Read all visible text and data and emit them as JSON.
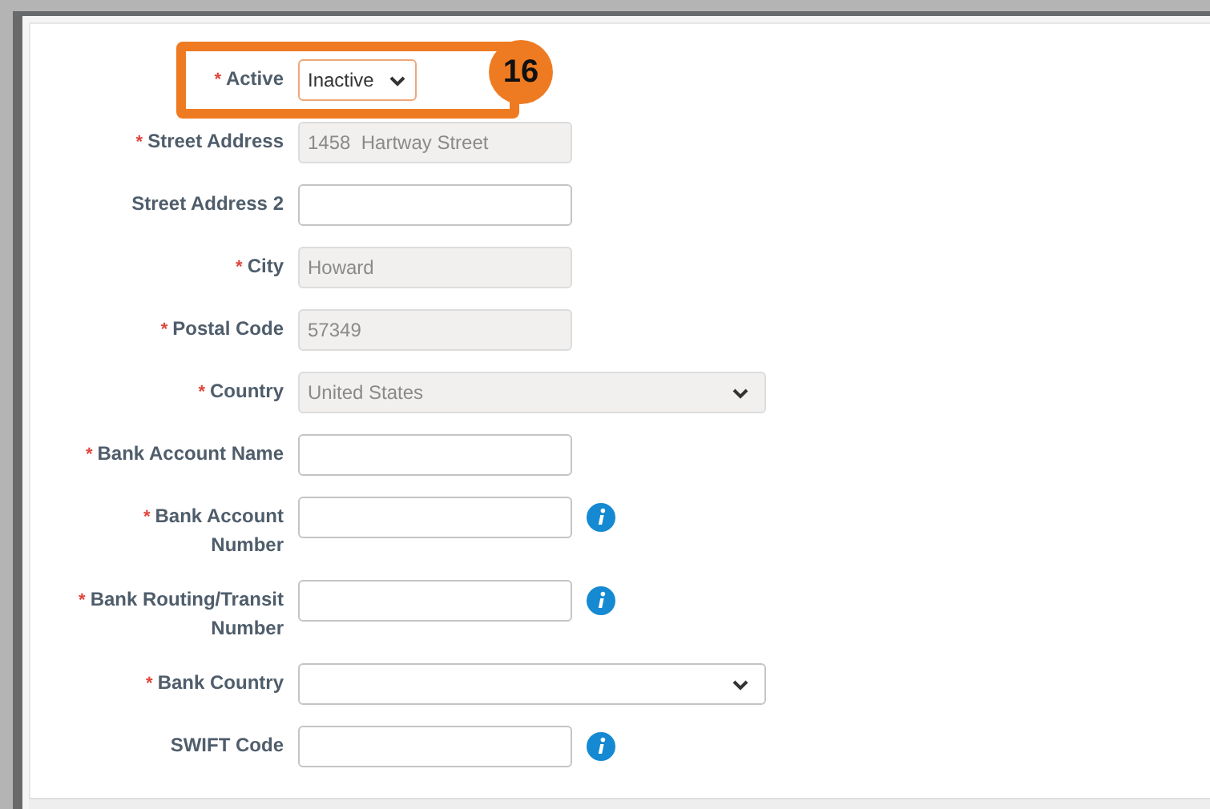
{
  "fields": [
    {
      "label": "Active",
      "required_mark": "*",
      "kind": "compact-select",
      "value": "Inactive",
      "disabled": false,
      "info": false,
      "highlighted": true,
      "callout": "16"
    },
    {
      "label": "Street Address",
      "required_mark": "*",
      "kind": "text",
      "value": "1458  Hartway Street",
      "disabled": true,
      "info": false,
      "highlighted": false
    },
    {
      "label": "Street Address 2",
      "kind": "text",
      "disabled": false,
      "info": false,
      "highlighted": false
    },
    {
      "label": "City",
      "required_mark": "*",
      "kind": "text",
      "value": "Howard",
      "disabled": true,
      "info": false,
      "highlighted": false
    },
    {
      "label": "Postal Code",
      "required_mark": "*",
      "kind": "text",
      "value": "57349",
      "disabled": true,
      "info": false,
      "highlighted": false
    },
    {
      "label": "Country",
      "required_mark": "*",
      "kind": "select",
      "value": "United States",
      "disabled": true,
      "info": false,
      "highlighted": false
    },
    {
      "label": "Bank Account Name",
      "required_mark": "*",
      "kind": "text",
      "disabled": false,
      "info": false,
      "highlighted": false
    },
    {
      "label": "Bank Account Number",
      "required_mark": "*",
      "kind": "text",
      "disabled": false,
      "info": true,
      "highlighted": false
    },
    {
      "label": "Bank Routing/Transit Number",
      "required_mark": "*",
      "kind": "text",
      "disabled": false,
      "info": true,
      "highlighted": false
    },
    {
      "label": "Bank Country",
      "required_mark": "*",
      "kind": "select",
      "disabled": false,
      "info": false,
      "highlighted": false
    },
    {
      "label": "SWIFT Code",
      "kind": "text",
      "disabled": false,
      "info": true,
      "highlighted": false
    }
  ]
}
